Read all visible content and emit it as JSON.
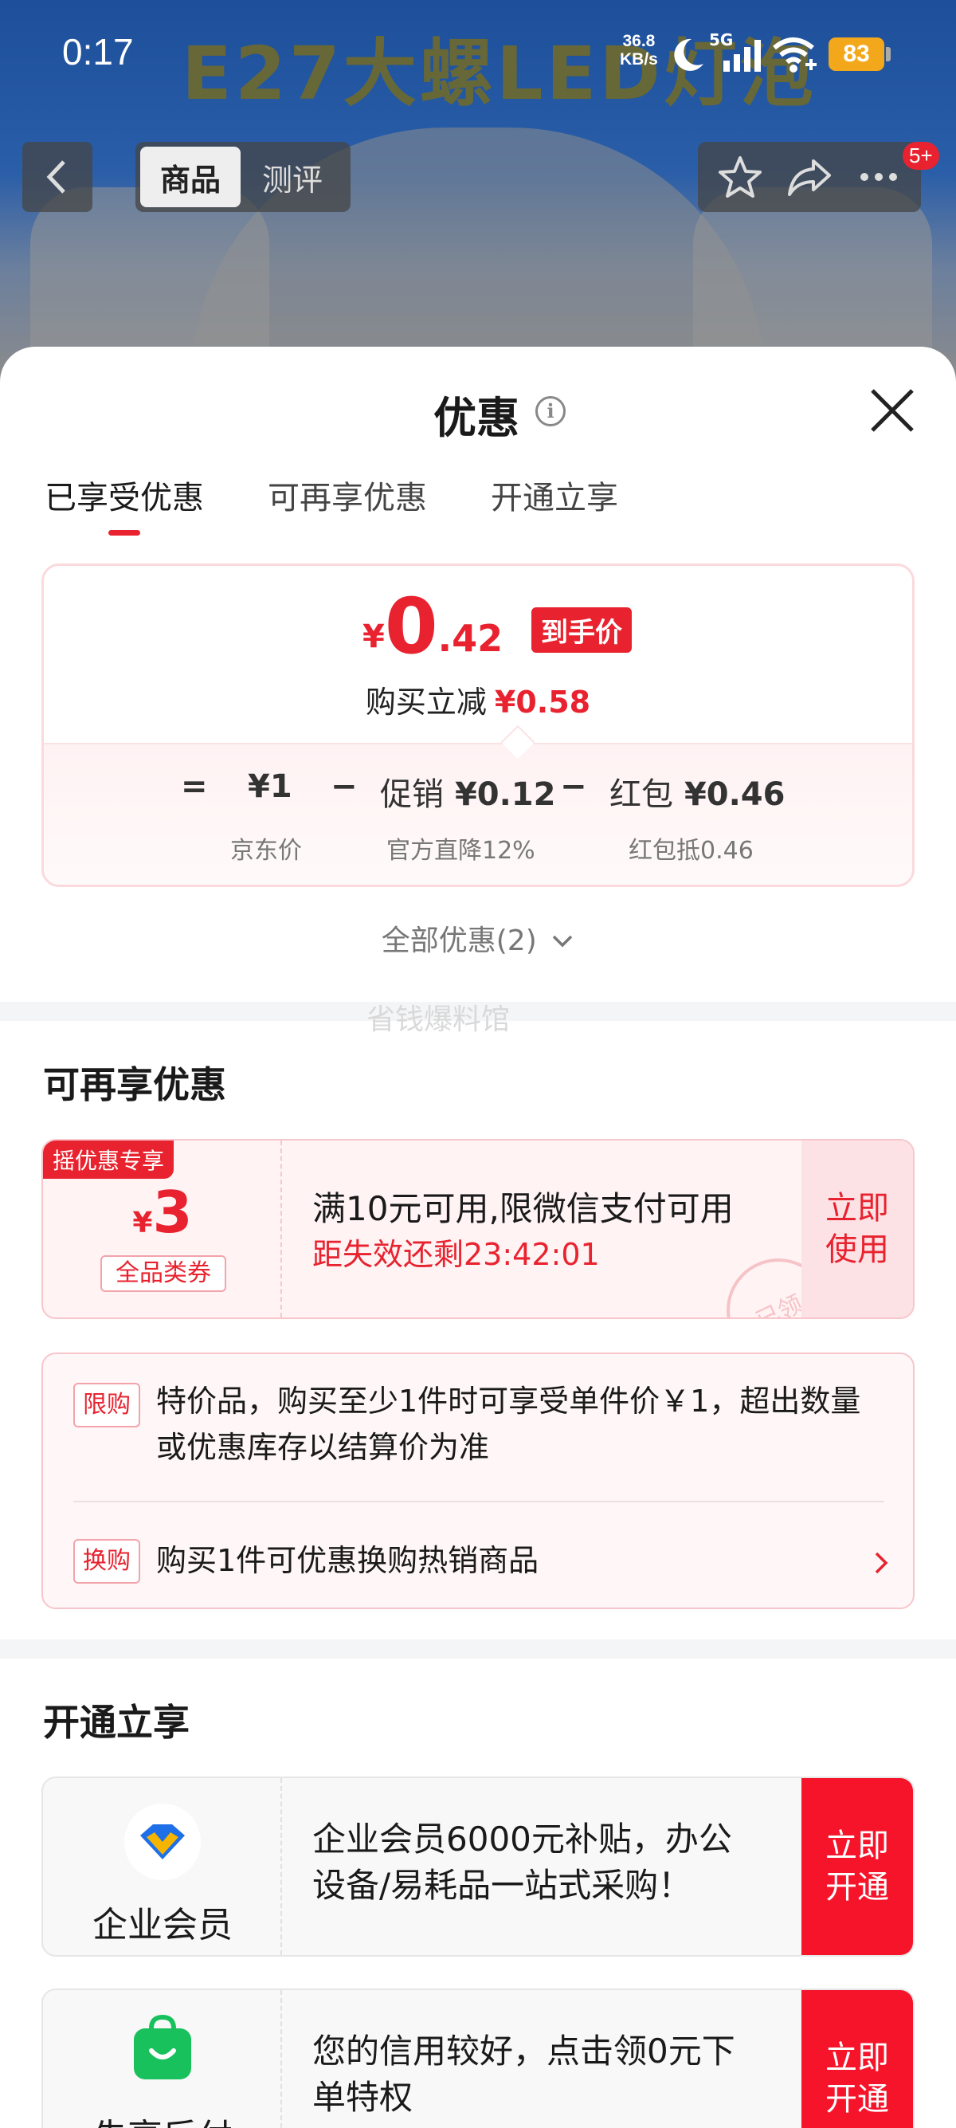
{
  "status_bar": {
    "time": "0:17",
    "net_speed_value": "36.8",
    "net_speed_unit": "KB/s",
    "network": "5G",
    "battery": "83"
  },
  "background": {
    "banner_text": "E27大螺LED灯泡"
  },
  "nav": {
    "tabs": [
      {
        "label": "商品",
        "active": true
      },
      {
        "label": "测评",
        "active": false
      }
    ],
    "badge": "5+"
  },
  "sheet": {
    "title": "优惠",
    "tabs": [
      {
        "label": "已享受优惠",
        "active": true
      },
      {
        "label": "可再享优惠",
        "active": false
      },
      {
        "label": "开通立享",
        "active": false
      }
    ],
    "price_card": {
      "currency": "¥",
      "price_integer": "0",
      "price_decimal": ".42",
      "price_tag": "到手价",
      "reduce_label": "购买立减",
      "reduce_amount": "¥0.58",
      "equals": "=",
      "minus": "−",
      "breakdown": [
        {
          "label": "",
          "amount": "¥1",
          "sub": "京东价"
        },
        {
          "label": "促销",
          "amount": "¥0.12",
          "sub": "官方直降12%"
        },
        {
          "label": "红包",
          "amount": "¥0.46",
          "sub": "红包抵0.46"
        }
      ]
    },
    "all_discounts": "全部优惠(2)",
    "watermark": "省钱爆料馆",
    "section_more": {
      "title": "可再享优惠",
      "coupon": {
        "badge": "摇优惠专享",
        "currency": "¥",
        "amount": "3",
        "kind": "全品类券",
        "desc": "满10元可用,限微信支付可用",
        "expire": "距失效还剩23:42:01",
        "button": "立即使用",
        "stamp": "已领"
      },
      "rules": [
        {
          "tag": "限购",
          "text": "特价品，购买至少1件时可享受单件价￥1，超出数量或优惠库存以结算价为准"
        },
        {
          "tag": "换购",
          "text": "购买1件可优惠换购热销商品"
        }
      ]
    },
    "section_open": {
      "title": "开通立享",
      "cards": [
        {
          "name": "企业会员",
          "desc": "企业会员6000元补贴，办公设备/易耗品一站式采购！",
          "button": "立即开通",
          "icon": "enterprise-member-icon"
        },
        {
          "name": "先享后付",
          "desc": "您的信用较好，点击领0元下单特权",
          "button": "立即开通",
          "icon": "shopping-bag-icon"
        }
      ]
    }
  },
  "colors": {
    "accent_red": "#e8232f",
    "button_red": "#f5142a",
    "battery": "#f3a81b",
    "member_green": "#18c15c"
  }
}
